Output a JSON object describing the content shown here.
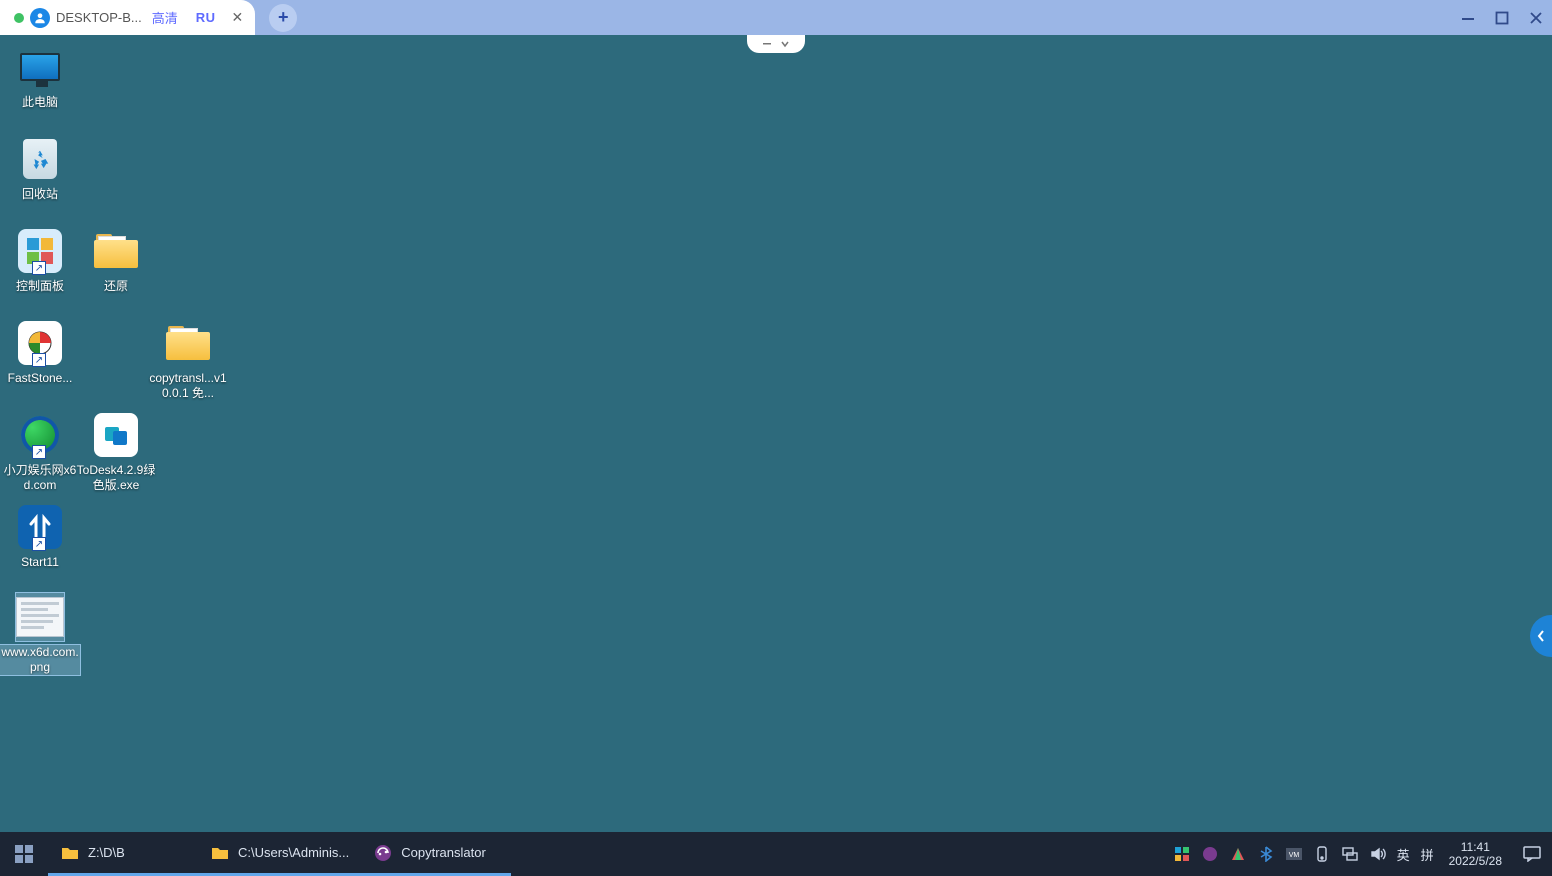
{
  "tabbar": {
    "tab_title": "DESKTOP-B...",
    "quality_label": "高清",
    "ru_label": "RU"
  },
  "desktop_icons": {
    "this_pc": "此电脑",
    "recycle_bin": "回收站",
    "control_panel": "控制面板",
    "restore": "还原",
    "faststone": "FastStone...",
    "copytranslator_folder": "copytransl...v10.0.1 免...",
    "xiaodao": "小刀娱乐网x6d.com",
    "todesk": "ToDesk4.2.9绿色版.exe",
    "start11": "Start11",
    "png": "www.x6d.com.png"
  },
  "taskbar": {
    "items": [
      {
        "label": "Z:\\D\\B"
      },
      {
        "label": "C:\\Users\\Adminis..."
      },
      {
        "label": "Copytranslator"
      }
    ],
    "ime_lang": "英",
    "ime_mode": "拼",
    "time": "11:41",
    "date": "2022/5/28"
  }
}
